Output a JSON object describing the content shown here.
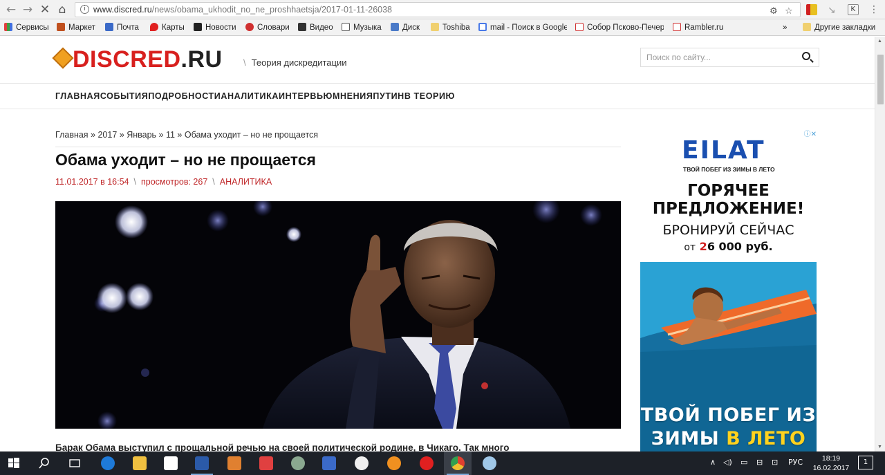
{
  "browser": {
    "url_host": "www.discred.ru",
    "url_path": "/news/obama_ukhodit_no_ne_proshhaetsja/2017-01-11-26038"
  },
  "bookmarks": [
    {
      "label": "Сервисы",
      "color": "#e04040"
    },
    {
      "label": "Маркет",
      "color": "#c0501e"
    },
    {
      "label": "Почта",
      "color": "#3b6ac8"
    },
    {
      "label": "Карты",
      "color": "#e02020"
    },
    {
      "label": "Новости",
      "color": "#222222"
    },
    {
      "label": "Словари",
      "color": "#d03030"
    },
    {
      "label": "Видео",
      "color": "#333333"
    },
    {
      "label": "Музыка",
      "color": "#555555"
    },
    {
      "label": "Диск",
      "color": "#4a7ac8"
    },
    {
      "label": "Toshiba",
      "color": "#f0d070"
    },
    {
      "label": "mail - Поиск в Google",
      "color": "#4a7ae8"
    },
    {
      "label": "Собор Псково-Печер",
      "color": "#d03030"
    },
    {
      "label": "Rambler.ru",
      "color": "#d03030"
    },
    {
      "label": "»",
      "color": ""
    },
    {
      "label": "Другие закладки",
      "color": "#f0d070"
    }
  ],
  "site": {
    "logo_red": "DISCRED",
    "logo_dark": ".RU",
    "tagline_sep": "\\",
    "tagline": "Теория дискредитации",
    "search_placeholder": "Поиск по сайту..."
  },
  "nav": [
    "ГЛАВНАЯ",
    "СОБЫТИЯ",
    "ПОДРОБНОСТИ",
    "АНАЛИТИКА",
    "ИНТЕРВЬЮ",
    "МНЕНИЯ",
    "ПУТИН",
    "В ТЕОРИЮ"
  ],
  "breadcrumbs": [
    "Главная",
    "2017",
    "Январь",
    "11",
    "Обама уходит – но не прощается"
  ],
  "article": {
    "title": "Обама уходит – но не прощается",
    "date": "11.01.2017 в 16:54",
    "views": "просмотров: 267",
    "category": "АНАЛИТИКА",
    "meta_sep": "\\",
    "first_para": "Барак Обама выступил с прощальной речью на своей политической родине, в Чикаго. Так много"
  },
  "ad": {
    "badge": "ⓘ✕",
    "logo": "EILAT",
    "logo_sub": "ТВОЙ ПОБЕГ ИЗ ЗИМЫ В ЛЕТО",
    "hot_line1": "ГОРЯЧЕЕ",
    "hot_line2": "ПРЕДЛОЖЕНИЕ!",
    "book": "БРОНИРУЙ СЕЙЧАС",
    "price_prefix": "от",
    "price_digit": "2",
    "price_rest": "6 000 руб.",
    "bottom_line1": "ТВОЙ ПОБЕГ ИЗ",
    "bottom_line2a": "ЗИМЫ",
    "bottom_line2b": "В ЛЕТО"
  },
  "tray": {
    "lang": "РУС",
    "time": "18:19",
    "date": "16.02.2017",
    "notif": "1"
  }
}
